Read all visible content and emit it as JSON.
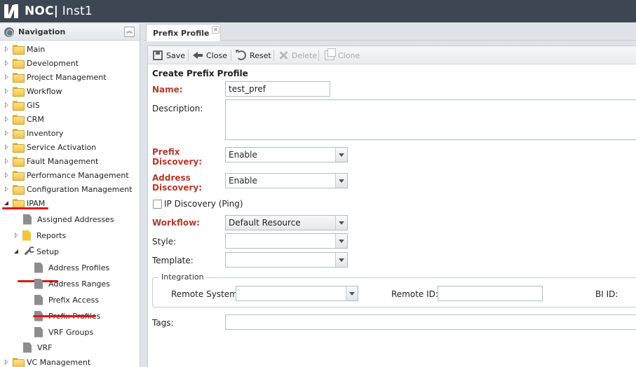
{
  "header": {
    "logo_alt": "noc-logo",
    "brand": "NOC|",
    "instance": "Inst1"
  },
  "nav": {
    "title": "Navigation",
    "items": [
      {
        "label": "Main"
      },
      {
        "label": "Development"
      },
      {
        "label": "Project Management"
      },
      {
        "label": "Workflow"
      },
      {
        "label": "GIS"
      },
      {
        "label": "CRM"
      },
      {
        "label": "Inventory"
      },
      {
        "label": "Service Activation"
      },
      {
        "label": "Fault Management"
      },
      {
        "label": "Performance Management"
      },
      {
        "label": "Configuration Management"
      },
      {
        "label": "IPAM"
      }
    ],
    "ipam_children": {
      "assigned": "Assigned Addresses",
      "reports": "Reports",
      "setup": "Setup",
      "setup_children": [
        "Address Profiles",
        "Address Ranges",
        "Prefix Access",
        "Prefix Profiles",
        "VRF Groups"
      ],
      "vrf": "VRF"
    },
    "after": "VC Management"
  },
  "tab": {
    "label": "Prefix Profile",
    "close": "×"
  },
  "toolbar": {
    "save": "Save",
    "close": "Close",
    "reset": "Reset",
    "delete": "Delete",
    "clone": "Clone"
  },
  "form": {
    "title": "Create Prefix Profile",
    "name_label": "Name:",
    "name_value": "test_pref",
    "description_label": "Description:",
    "prefix_discovery_label_1": "Prefix",
    "prefix_discovery_label_2": "Discovery:",
    "prefix_discovery_value": "Enable",
    "address_discovery_label_1": "Address",
    "address_discovery_label_2": "Discovery:",
    "address_discovery_value": "Enable",
    "ip_discovery_label": "IP Discovery (Ping)",
    "workflow_label": "Workflow:",
    "workflow_value": "Default Resource",
    "style_label": "Style:",
    "template_label": "Template:",
    "integration_legend": "Integration",
    "remote_system_label": "Remote System:",
    "remote_id_label": "Remote ID:",
    "bi_id_label": "BI ID:",
    "tags_label": "Tags:"
  }
}
